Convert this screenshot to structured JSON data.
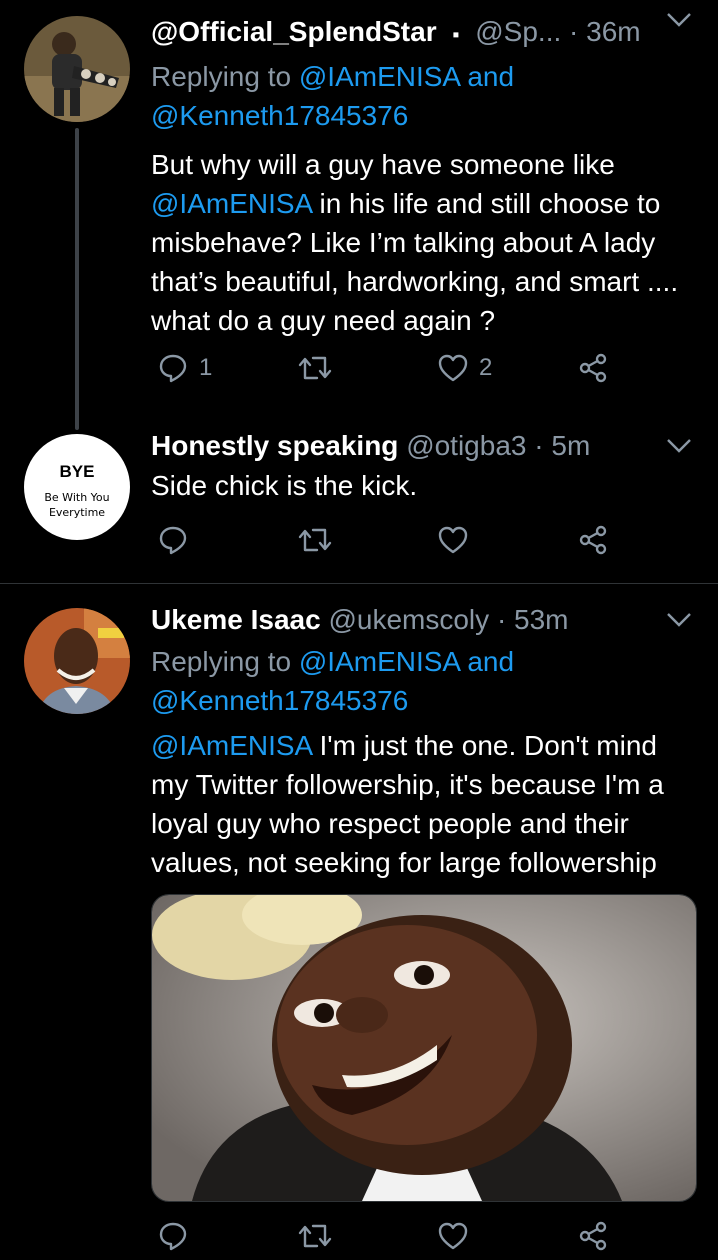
{
  "tweets": [
    {
      "name": "@Official_SplendStar",
      "verified_mark": "▪",
      "handle": "@Sp...",
      "time": "· 36m",
      "replying_prefix": "Replying to",
      "reply_user1": "@IAmENISA",
      "reply_and": "and",
      "reply_user2": "@Kenneth17845376",
      "mention": "@IAmENISA",
      "text_before": "But why will a guy have someone like",
      "text_after": "in his life and still choose to misbehave? Like I’m talking about A lady that’s beautiful, hardworking, and smart .... what do a guy need again ?",
      "reply_count": "1",
      "retweet_count": "",
      "like_count": "2"
    },
    {
      "name": "Honestly speaking",
      "handle": "@otigba3",
      "time": "· 5m",
      "text": "Side chick is the kick.",
      "avatar_title": "BYE",
      "avatar_sub1": "Be With You",
      "avatar_sub2": "Everytime"
    },
    {
      "name": "Ukeme Isaac",
      "handle": "@ukemscoly",
      "time": "· 53m",
      "replying_prefix": "Replying to",
      "reply_user1": "@IAmENISA",
      "reply_and": "and",
      "reply_user2": "@Kenneth17845376",
      "mention": "@IAmENISA",
      "text_after": "I'm just the one. Don't mind my Twitter followership, it's because I'm a loyal guy who respect people and their values, not seeking for large followership"
    }
  ],
  "colors": {
    "background": "#000000",
    "link": "#1d9bf0",
    "muted": "#8b98a5",
    "divider": "#2f3336"
  },
  "icons": [
    "reply-icon",
    "retweet-icon",
    "like-icon",
    "share-icon",
    "chevron-down-icon"
  ]
}
